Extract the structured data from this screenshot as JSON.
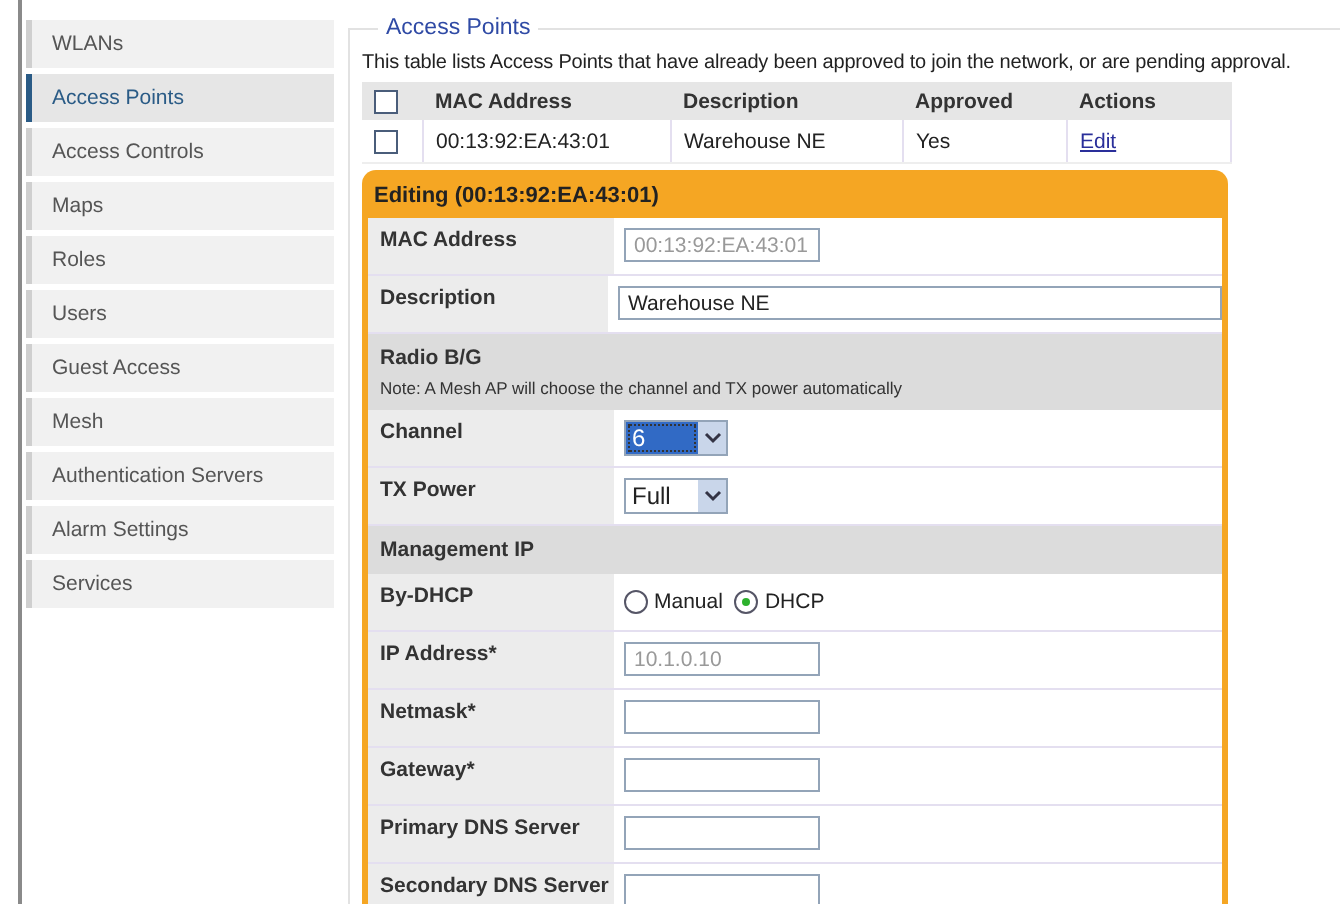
{
  "sidebar": {
    "items": [
      {
        "label": "WLANs",
        "selected": false
      },
      {
        "label": "Access Points",
        "selected": true
      },
      {
        "label": "Access Controls",
        "selected": false
      },
      {
        "label": "Maps",
        "selected": false
      },
      {
        "label": "Roles",
        "selected": false
      },
      {
        "label": "Users",
        "selected": false
      },
      {
        "label": "Guest Access",
        "selected": false
      },
      {
        "label": "Mesh",
        "selected": false
      },
      {
        "label": "Authentication Servers",
        "selected": false
      },
      {
        "label": "Alarm Settings",
        "selected": false
      },
      {
        "label": "Services",
        "selected": false
      }
    ]
  },
  "panel": {
    "title": "Access Points",
    "description": "This table lists Access Points that have already been approved to join the network, or are pending approval.",
    "table": {
      "select_all_checked": false,
      "columns": [
        "MAC Address",
        "Description",
        "Approved",
        "Actions"
      ],
      "rows": [
        {
          "checked": false,
          "mac": "00:13:92:EA:43:01",
          "description": "Warehouse NE",
          "approved": "Yes",
          "action": "Edit"
        }
      ]
    },
    "editor": {
      "title": "Editing (00:13:92:EA:43:01)",
      "rows": [
        {
          "kind": "text",
          "label": "MAC Address",
          "value": "00:13:92:EA:43:01",
          "disabled": true,
          "wide": false
        },
        {
          "kind": "text",
          "label": "Description",
          "value": "Warehouse NE",
          "disabled": false,
          "wide": true
        },
        {
          "kind": "section",
          "label": "Radio B/G",
          "note": "Note: A Mesh AP will choose the channel and TX power automatically"
        },
        {
          "kind": "select",
          "label": "Channel",
          "value": "6",
          "focused": true
        },
        {
          "kind": "select",
          "label": "TX Power",
          "value": "Full",
          "focused": false
        },
        {
          "kind": "section",
          "label": "Management IP"
        },
        {
          "kind": "radio",
          "label": "By-DHCP",
          "options": [
            {
              "label": "Manual",
              "selected": false
            },
            {
              "label": "DHCP",
              "selected": true
            }
          ]
        },
        {
          "kind": "text",
          "label": "IP Address*",
          "value": "10.1.0.10",
          "disabled": true,
          "wide": false
        },
        {
          "kind": "text",
          "label": "Netmask*",
          "wide": false
        },
        {
          "kind": "text",
          "label": "Gateway*",
          "wide": false
        },
        {
          "kind": "text",
          "label": "Primary DNS Server",
          "wide": false
        },
        {
          "kind": "text",
          "label": "Secondary DNS Server",
          "wide": false
        }
      ]
    }
  }
}
